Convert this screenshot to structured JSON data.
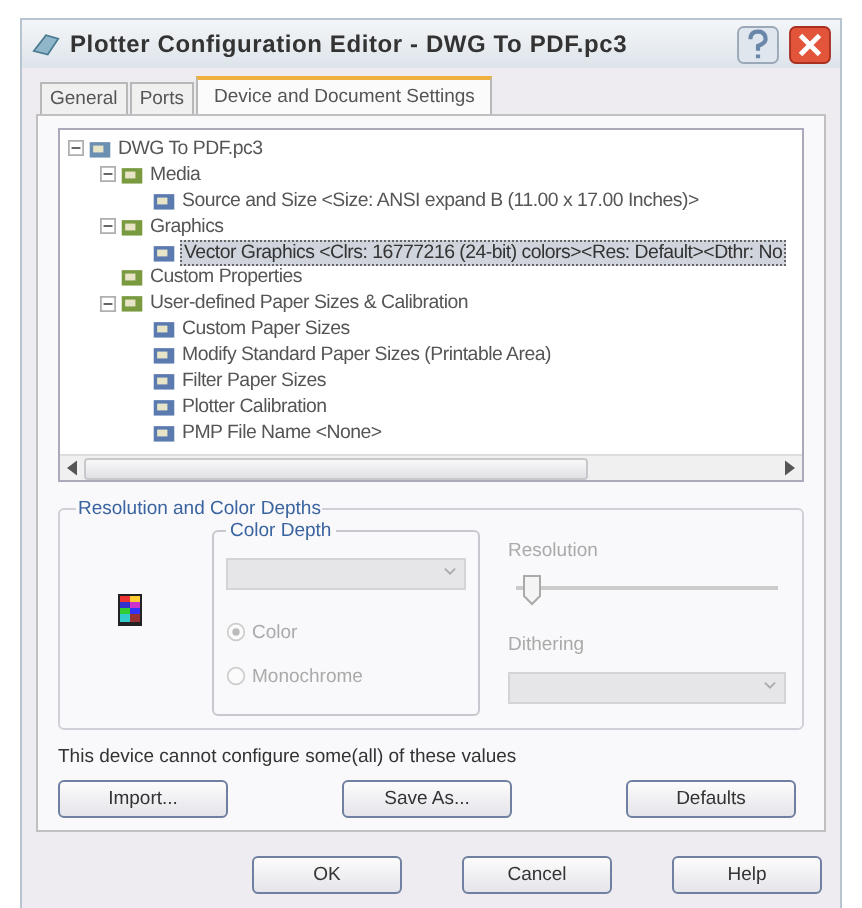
{
  "window": {
    "title": "Plotter Configuration Editor - DWG To PDF.pc3"
  },
  "tabs": [
    {
      "label": "General",
      "selected": false
    },
    {
      "label": "Ports",
      "selected": false
    },
    {
      "label": "Device and Document Settings",
      "selected": true
    }
  ],
  "tree": [
    {
      "label": "DWG To PDF.pc3",
      "selected": false,
      "expanded": true,
      "children": [
        {
          "label": "Media",
          "selected": false,
          "expanded": true,
          "children": [
            {
              "label": "Source and Size <Size: ANSI expand B (11.00 x 17.00 Inches)>",
              "selected": false
            }
          ]
        },
        {
          "label": "Graphics",
          "selected": false,
          "expanded": true,
          "children": [
            {
              "label": "Vector Graphics <Clrs: 16777216 (24-bit) colors><Res: Default><Dthr: No",
              "selected": true
            }
          ]
        },
        {
          "label": "Custom Properties",
          "selected": false
        },
        {
          "label": "User-defined Paper Sizes & Calibration",
          "selected": false,
          "expanded": true,
          "children": [
            {
              "label": "Custom Paper Sizes",
              "selected": false
            },
            {
              "label": "Modify Standard Paper Sizes (Printable Area)",
              "selected": false
            },
            {
              "label": "Filter Paper Sizes",
              "selected": false
            },
            {
              "label": "Plotter Calibration",
              "selected": false
            },
            {
              "label": "PMP File Name <None>",
              "selected": false
            }
          ]
        }
      ]
    }
  ],
  "group": {
    "title": "Resolution and Color Depths",
    "color_depth": {
      "title": "Color Depth",
      "dropdown_disabled": true,
      "radios": [
        {
          "label": "Color",
          "checked": true,
          "disabled": true
        },
        {
          "label": "Monochrome",
          "checked": false,
          "disabled": true
        }
      ]
    },
    "resolution": {
      "label": "Resolution",
      "level": 0.02,
      "disabled": true
    },
    "dithering": {
      "label": "Dithering",
      "disabled": true
    }
  },
  "note": "This device cannot configure some(all) of these values",
  "panel_buttons": [
    "Import...",
    "Save As...",
    "Defaults"
  ],
  "dialog_buttons": [
    "OK",
    "Cancel",
    "Help"
  ]
}
